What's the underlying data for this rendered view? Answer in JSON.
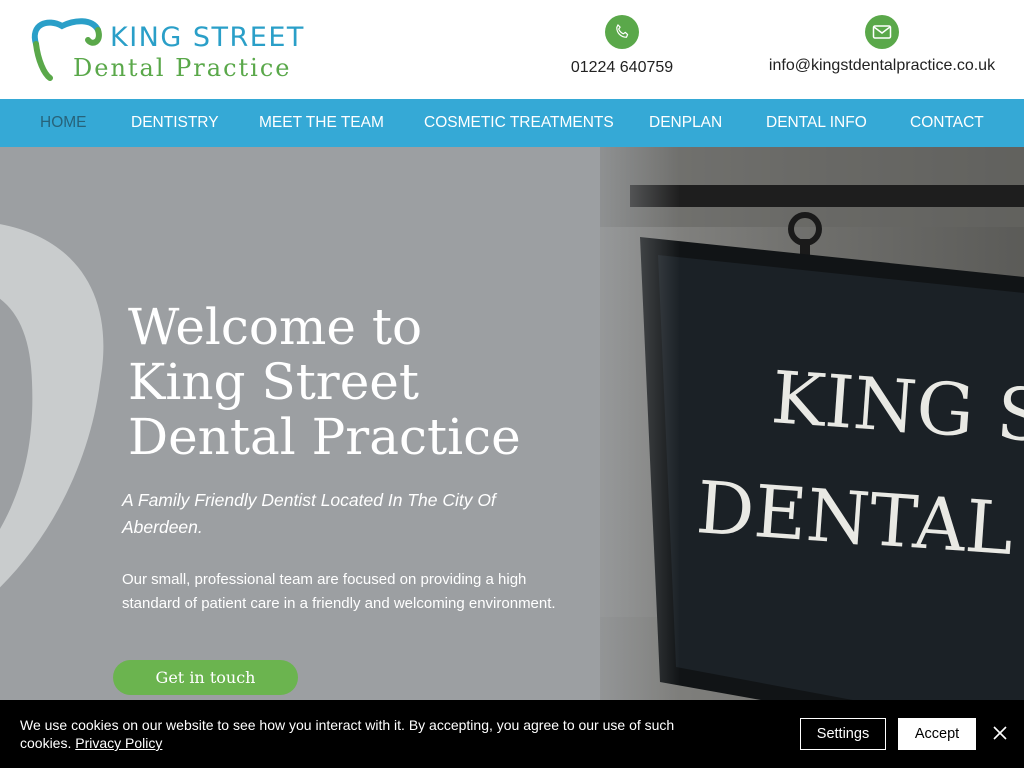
{
  "header": {
    "logo_line1": "KING STREET",
    "logo_line2": "Dental Practice",
    "phone": "01224 640759",
    "email": "info@kingstdentalpractice.co.uk",
    "phone_icon": "phone-icon",
    "email_icon": "envelope-icon"
  },
  "nav": {
    "items": [
      {
        "label": "HOME",
        "active": true
      },
      {
        "label": "DENTISTRY",
        "active": false
      },
      {
        "label": "MEET THE TEAM",
        "active": false
      },
      {
        "label": "COSMETIC TREATMENTS",
        "active": false
      },
      {
        "label": "DENPLAN",
        "active": false
      },
      {
        "label": "DENTAL INFO",
        "active": false
      },
      {
        "label": "CONTACT",
        "active": false
      }
    ]
  },
  "hero": {
    "title_lines": [
      "Welcome to",
      "King Street",
      "Dental Practice"
    ],
    "subtitle": "A Family Friendly Dentist Located In The City Of Aberdeen.",
    "body": "Our small, professional team are focused on providing a high standard of patient care in a  friendly and welcoming environment.",
    "cta": "Get in touch",
    "sign_line1": "KING ST",
    "sign_line2": "DENTAL PR"
  },
  "cookie": {
    "text": "We use cookies on our website to see how you interact with it. By accepting, you agree to our use of such cookies.",
    "link": "Privacy Policy",
    "settings": "Settings",
    "accept": "Accept",
    "close_icon": "close-icon"
  },
  "colors": {
    "brand_blue": "#35a9d6",
    "brand_green": "#5aa84a",
    "cta_green": "#6bb44f",
    "nav_active": "#27637a",
    "hero_bg": "#9c9fa2",
    "cookie_bg": "#000000"
  }
}
